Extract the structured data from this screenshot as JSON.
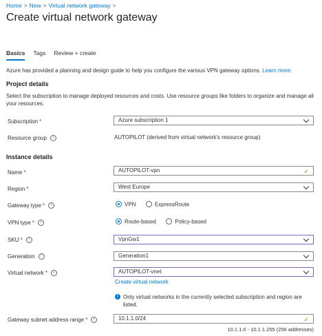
{
  "breadcrumb": [
    "Home",
    "New",
    "Virtual network gateway"
  ],
  "title": "Create virtual network gateway",
  "tabs": [
    "Basics",
    "Tags",
    "Review + create"
  ],
  "intro": "Azure has provided a planning and design guide to help you configure the various VPN gateway options.",
  "intro_link": "Learn more.",
  "project": {
    "heading": "Project details",
    "desc": "Select the subscription to manage deployed resources and costs. Use resource groups like folders to organize and manage all your resources.",
    "subscription_label": "Subscription",
    "subscription_value": "Azure subscription 1",
    "rg_label": "Resource group",
    "rg_value": "AUTOPILOT (derived from virtual network's resource group)"
  },
  "instance": {
    "heading": "Instance details",
    "name_label": "Name",
    "name_value": "AUTOPILOT-vpn",
    "region_label": "Region",
    "region_value": "West Europe",
    "gwtype_label": "Gateway type",
    "gwtype_options": [
      "VPN",
      "ExpressRoute"
    ],
    "vpntype_label": "VPN type",
    "vpntype_options": [
      "Route-based",
      "Policy-based"
    ],
    "sku_label": "SKU",
    "sku_value": "VpnGw1",
    "gen_label": "Generation",
    "gen_value": "Generation1",
    "vnet_label": "Virtual network",
    "vnet_value": "AUTOPILOT-vnet",
    "vnet_link": "Create virtual network",
    "vnet_info": "Only virtual networks in the currently selected subscription and region are listed.",
    "subnet_label": "Gateway subnet address range",
    "subnet_value": "10.1.1.0/24",
    "subnet_hint": "10.1.1.0 - 10.1.1.255 (256 addresses)"
  },
  "colors": {
    "accent": "#0078d4",
    "required": "#a4262c",
    "valid": "#57a300",
    "focus": "#8764b8"
  }
}
